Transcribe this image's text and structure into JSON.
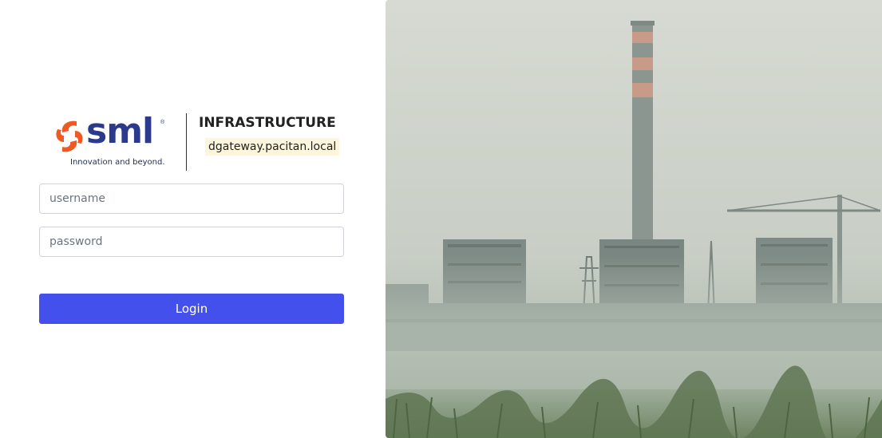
{
  "brand": {
    "name": "sml",
    "registered_mark": "®",
    "tagline": "Innovation and beyond.",
    "primary_color": "#2b3a8c",
    "accent_color": "#ef5a24"
  },
  "app": {
    "title": "INFRASTRUCTURE",
    "host": "dgateway.pacitan.local"
  },
  "form": {
    "username_placeholder": "username",
    "password_placeholder": "password",
    "login_label": "Login",
    "button_color": "#4450ec"
  },
  "hero": {
    "icon": "power-plant-photo"
  }
}
